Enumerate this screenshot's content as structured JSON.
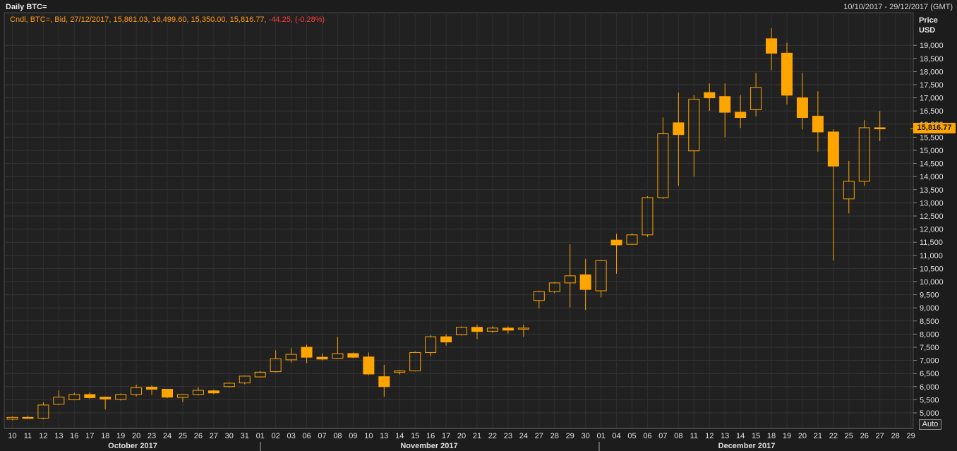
{
  "header": {
    "title": "Daily BTC=",
    "date_range": "10/10/2017 - 29/12/2017 (GMT)"
  },
  "legend": {
    "prefix": "Cndl, BTC=, Bid, 27/12/2017, 15,861.03, 16,499.60, 15,350.00, 15,816.77,",
    "change": "-44.25, (-0.28%)"
  },
  "axis": {
    "price_label_line1": "Price",
    "price_label_line2": "USD",
    "auto_button": "Auto",
    "last_price": "15,816.77"
  },
  "colors": {
    "candle": "#ffa500",
    "background": "#1c1c1c",
    "grid": "#3a3a3a",
    "negative": "#ff3b3b"
  },
  "chart_data": {
    "type": "candlestick",
    "title": "Daily BTC=",
    "ylabel": "Price USD",
    "ylim": [
      4600,
      19600
    ],
    "y_ticks": [
      "5,000",
      "5,500",
      "6,000",
      "6,500",
      "7,000",
      "7,500",
      "8,000",
      "8,500",
      "9,000",
      "9,500",
      "10,000",
      "10,500",
      "11,000",
      "11,500",
      "12,000",
      "12,500",
      "13,000",
      "13,500",
      "14,000",
      "14,500",
      "15,000",
      "15,500",
      "16,000",
      "16,500",
      "17,000",
      "17,500",
      "18,000",
      "18,500",
      "19,000"
    ],
    "months": [
      "October 2017",
      "November 2017",
      "December 2017"
    ],
    "x_labels": [
      "10",
      "11",
      "12",
      "13",
      "16",
      "17",
      "18",
      "19",
      "20",
      "23",
      "24",
      "25",
      "26",
      "27",
      "30",
      "31",
      "01",
      "02",
      "03",
      "06",
      "07",
      "08",
      "09",
      "10",
      "13",
      "14",
      "15",
      "16",
      "17",
      "20",
      "21",
      "22",
      "23",
      "24",
      "27",
      "28",
      "29",
      "30",
      "01",
      "04",
      "05",
      "06",
      "07",
      "08",
      "11",
      "12",
      "13",
      "14",
      "15",
      "18",
      "19",
      "20",
      "21",
      "22",
      "25",
      "26",
      "27",
      "28",
      "29"
    ],
    "candles": [
      {
        "x": "10",
        "open": 4760,
        "high": 4860,
        "low": 4720,
        "close": 4830
      },
      {
        "x": "11",
        "open": 4830,
        "high": 4900,
        "low": 4790,
        "close": 4790
      },
      {
        "x": "12",
        "open": 4800,
        "high": 5400,
        "low": 4760,
        "close": 5300
      },
      {
        "x": "13",
        "open": 5330,
        "high": 5850,
        "low": 5300,
        "close": 5600
      },
      {
        "x": "16",
        "open": 5500,
        "high": 5770,
        "low": 5480,
        "close": 5700
      },
      {
        "x": "17",
        "open": 5700,
        "high": 5780,
        "low": 5520,
        "close": 5580
      },
      {
        "x": "18",
        "open": 5600,
        "high": 5620,
        "low": 5140,
        "close": 5530
      },
      {
        "x": "19",
        "open": 5520,
        "high": 5740,
        "low": 5470,
        "close": 5700
      },
      {
        "x": "20",
        "open": 5700,
        "high": 6080,
        "low": 5620,
        "close": 5960
      },
      {
        "x": "23",
        "open": 5980,
        "high": 6050,
        "low": 5680,
        "close": 5900
      },
      {
        "x": "24",
        "open": 5900,
        "high": 5910,
        "low": 5560,
        "close": 5600
      },
      {
        "x": "25",
        "open": 5590,
        "high": 5720,
        "low": 5410,
        "close": 5700
      },
      {
        "x": "26",
        "open": 5700,
        "high": 5980,
        "low": 5660,
        "close": 5860
      },
      {
        "x": "27",
        "open": 5840,
        "high": 5880,
        "low": 5720,
        "close": 5760
      },
      {
        "x": "30",
        "open": 6000,
        "high": 6160,
        "low": 5970,
        "close": 6130
      },
      {
        "x": "31",
        "open": 6140,
        "high": 6420,
        "low": 6090,
        "close": 6400
      },
      {
        "x": "01",
        "open": 6370,
        "high": 6600,
        "low": 6350,
        "close": 6550
      },
      {
        "x": "02",
        "open": 6570,
        "high": 7380,
        "low": 6540,
        "close": 7060
      },
      {
        "x": "03",
        "open": 7020,
        "high": 7480,
        "low": 6920,
        "close": 7230
      },
      {
        "x": "06",
        "open": 7500,
        "high": 7600,
        "low": 6900,
        "close": 7120
      },
      {
        "x": "07",
        "open": 7120,
        "high": 7260,
        "low": 7000,
        "close": 7050
      },
      {
        "x": "08",
        "open": 7080,
        "high": 7900,
        "low": 7060,
        "close": 7260
      },
      {
        "x": "09",
        "open": 7260,
        "high": 7300,
        "low": 7080,
        "close": 7120
      },
      {
        "x": "10",
        "open": 7130,
        "high": 7300,
        "low": 6440,
        "close": 6480
      },
      {
        "x": "13",
        "open": 6380,
        "high": 6830,
        "low": 5620,
        "close": 6000
      },
      {
        "x": "14",
        "open": 6550,
        "high": 6630,
        "low": 6460,
        "close": 6600
      },
      {
        "x": "15",
        "open": 6600,
        "high": 7340,
        "low": 6580,
        "close": 7300
      },
      {
        "x": "16",
        "open": 7300,
        "high": 7960,
        "low": 7160,
        "close": 7900
      },
      {
        "x": "17",
        "open": 7900,
        "high": 8000,
        "low": 7560,
        "close": 7700
      },
      {
        "x": "20",
        "open": 7980,
        "high": 8300,
        "low": 7950,
        "close": 8260
      },
      {
        "x": "21",
        "open": 8260,
        "high": 8360,
        "low": 7820,
        "close": 8100
      },
      {
        "x": "22",
        "open": 8110,
        "high": 8300,
        "low": 8050,
        "close": 8230
      },
      {
        "x": "23",
        "open": 8230,
        "high": 8300,
        "low": 8020,
        "close": 8150
      },
      {
        "x": "24",
        "open": 8200,
        "high": 8360,
        "low": 7900,
        "close": 8230
      },
      {
        "x": "27",
        "open": 9280,
        "high": 9650,
        "low": 8980,
        "close": 9620
      },
      {
        "x": "28",
        "open": 9620,
        "high": 9980,
        "low": 9560,
        "close": 9950
      },
      {
        "x": "29",
        "open": 9950,
        "high": 11420,
        "low": 9020,
        "close": 10220
      },
      {
        "x": "30",
        "open": 10260,
        "high": 10860,
        "low": 8920,
        "close": 9700
      },
      {
        "x": "01",
        "open": 9650,
        "high": 10830,
        "low": 9400,
        "close": 10800
      },
      {
        "x": "04",
        "open": 11580,
        "high": 11820,
        "low": 10300,
        "close": 11400
      },
      {
        "x": "05",
        "open": 11420,
        "high": 11850,
        "low": 11400,
        "close": 11780
      },
      {
        "x": "06",
        "open": 11780,
        "high": 13250,
        "low": 11700,
        "close": 13200
      },
      {
        "x": "07",
        "open": 13200,
        "high": 16250,
        "low": 13150,
        "close": 15630
      },
      {
        "x": "08",
        "open": 16050,
        "high": 17200,
        "low": 13650,
        "close": 15600
      },
      {
        "x": "11",
        "open": 14980,
        "high": 17100,
        "low": 14000,
        "close": 16950
      },
      {
        "x": "12",
        "open": 17200,
        "high": 17550,
        "low": 16500,
        "close": 17000
      },
      {
        "x": "13",
        "open": 17050,
        "high": 17550,
        "low": 15500,
        "close": 16450
      },
      {
        "x": "14",
        "open": 16450,
        "high": 17100,
        "low": 15850,
        "close": 16250
      },
      {
        "x": "15",
        "open": 16550,
        "high": 17950,
        "low": 16300,
        "close": 17400
      },
      {
        "x": "18",
        "open": 19250,
        "high": 19650,
        "low": 18050,
        "close": 18700
      },
      {
        "x": "19",
        "open": 18700,
        "high": 19100,
        "low": 16750,
        "close": 17100
      },
      {
        "x": "20",
        "open": 17000,
        "high": 17950,
        "low": 15800,
        "close": 16250
      },
      {
        "x": "21",
        "open": 16300,
        "high": 17250,
        "low": 14950,
        "close": 15700
      },
      {
        "x": "22",
        "open": 15700,
        "high": 15800,
        "low": 10800,
        "close": 14400
      },
      {
        "x": "25",
        "open": 13150,
        "high": 14600,
        "low": 12600,
        "close": 13820
      },
      {
        "x": "26",
        "open": 13820,
        "high": 16150,
        "low": 13650,
        "close": 15861
      },
      {
        "x": "27",
        "open": 15861.03,
        "high": 16499.6,
        "low": 15350.0,
        "close": 15816.77
      }
    ]
  }
}
